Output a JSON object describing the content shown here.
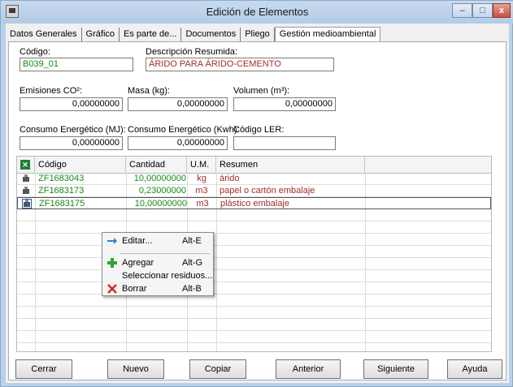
{
  "window": {
    "title": "Edición de Elementos",
    "min": "–",
    "max": "□",
    "close": "x"
  },
  "tabs": [
    "Datos Generales",
    "Gráfico",
    "Es parte de...",
    "Documentos",
    "Pliego",
    "Gestión medioambiental"
  ],
  "fields": {
    "codigo_label": "Código:",
    "codigo_value": "B039_01",
    "desc_label": "Descripción Resumida:",
    "desc_value": "ÁRIDO PARA ÁRIDO-CEMENTO",
    "emisiones_label": "Emisiones CO²:",
    "emisiones_value": "0,00000000",
    "masa_label": "Masa (kg):",
    "masa_value": "0,00000000",
    "volumen_label": "Volumen (m³):",
    "volumen_value": "0,00000000",
    "consumo_mj_label": "Consumo Energético (MJ):",
    "consumo_mj_value": "0,00000000",
    "consumo_kwh_label": "Consumo Energético (Kwh):",
    "consumo_kwh_value": "0,00000000",
    "ler_label": "Código LER:",
    "ler_value": ""
  },
  "grid": {
    "headers": {
      "code": "Código",
      "qty": "Cantidad",
      "um": "U.M.",
      "summary": "Resumen"
    },
    "rows": [
      {
        "code": "ZF1683043",
        "qty": "10,00000000",
        "um": "kg",
        "summary": "árido"
      },
      {
        "code": "ZF1683173",
        "qty": "0,23000000",
        "um": "m3",
        "summary": "papel o cartón embalaje"
      },
      {
        "code": "ZF1683175",
        "qty": "10,00000000",
        "um": "m3",
        "summary": "plástico embalaje"
      }
    ]
  },
  "context_menu": {
    "edit": "Editar...",
    "edit_shortcut": "Alt-E",
    "add": "Agregar",
    "add_shortcut": "Alt-G",
    "select": "Seleccionar residuos...",
    "delete": "Borrar",
    "delete_shortcut": "Alt-B"
  },
  "buttons": {
    "close": "Cerrar",
    "new": "Nuevo",
    "copy": "Copiar",
    "prev": "Anterior",
    "next": "Siguiente",
    "help": "Ayuda"
  }
}
